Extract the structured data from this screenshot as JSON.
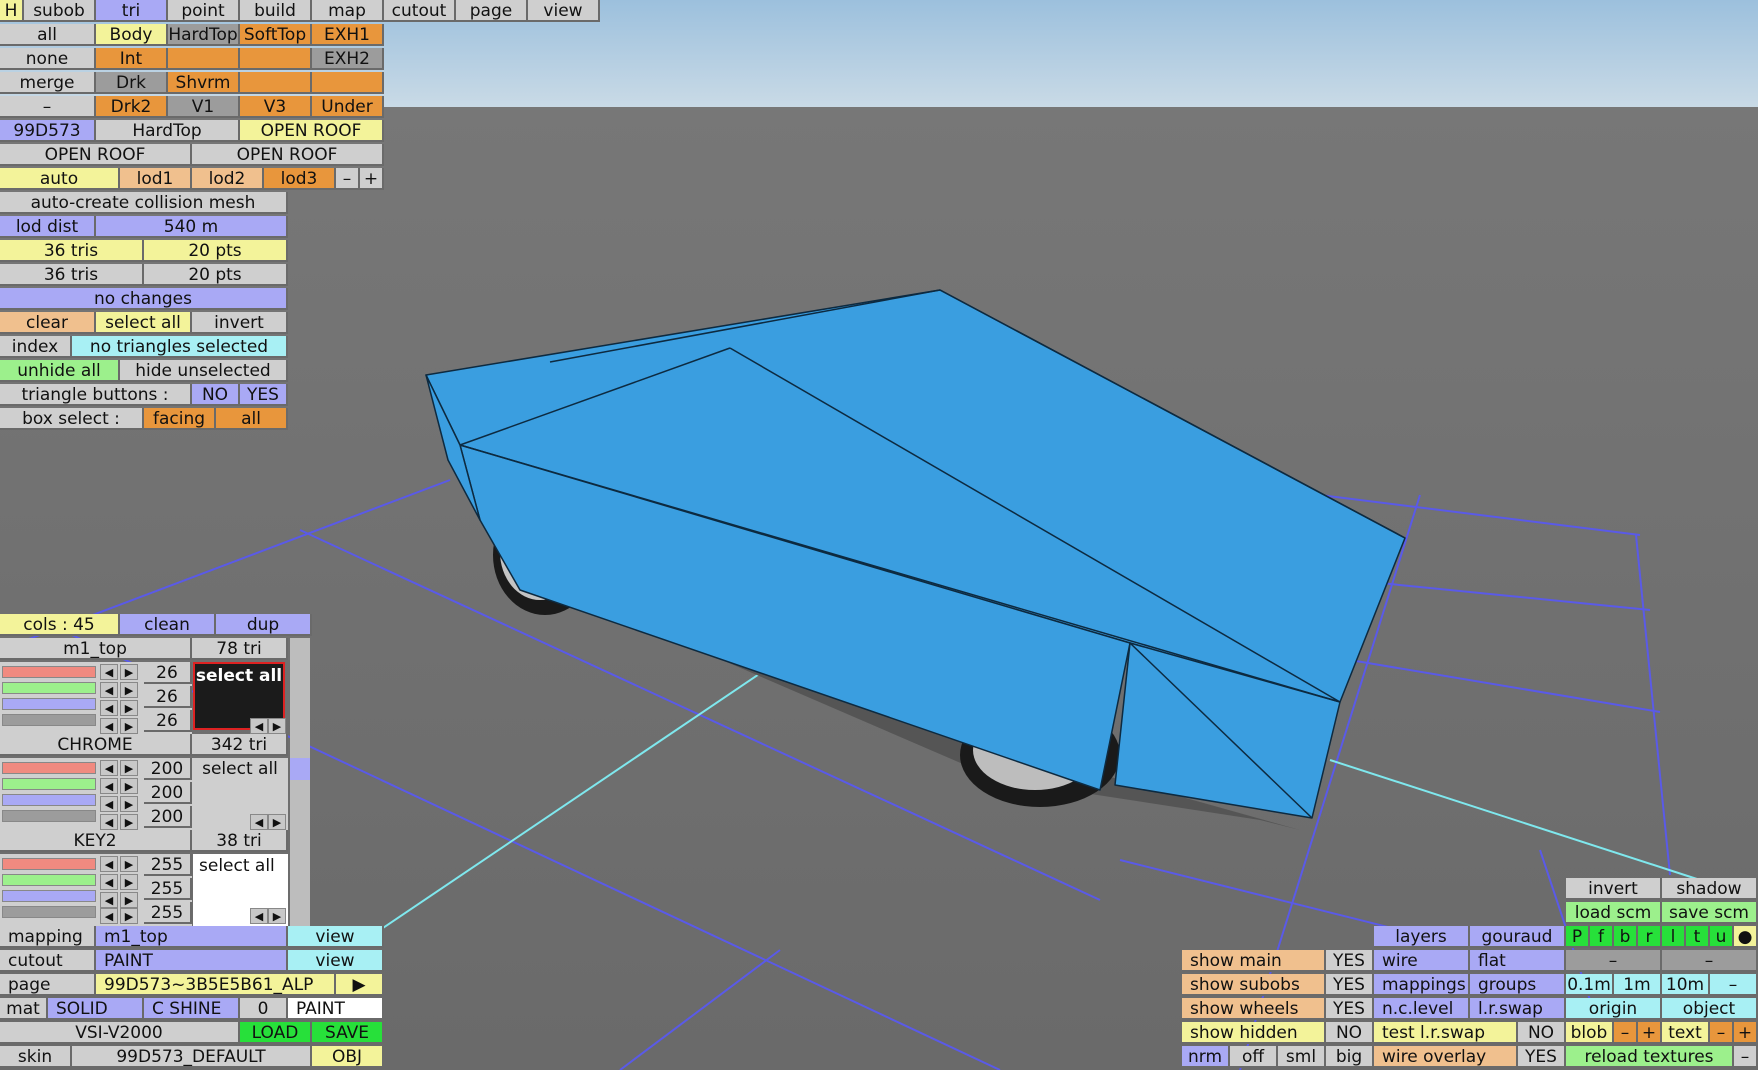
{
  "colors": {
    "car": "#3a9ee0",
    "grid": "#5a5ae8",
    "axis": "#7fe8ee",
    "sky": "#b7d0e2"
  },
  "menu": {
    "h": "H",
    "subob": "subob",
    "tri": "tri",
    "point": "point",
    "build": "build",
    "map": "map",
    "cutout": "cutout",
    "page": "page",
    "view": "view"
  },
  "sel": {
    "all": "all",
    "none": "none",
    "merge": "merge",
    "dash": "–",
    "body": "Body",
    "hardtop": "HardTop",
    "softtop": "SoftTop",
    "exh1": "EXH1",
    "int": "Int",
    "exh2": "EXH2",
    "drk": "Drk",
    "shvrm": "Shvrm",
    "drk2": "Drk2",
    "v1": "V1",
    "v3": "V3",
    "under": "Under"
  },
  "car_row": {
    "code": "99D573",
    "top": "HardTop",
    "roof": "OPEN ROOF"
  },
  "roof_row": {
    "a": "OPEN ROOF",
    "b": "OPEN ROOF"
  },
  "lod": {
    "auto": "auto",
    "lod1": "lod1",
    "lod2": "lod2",
    "lod3": "lod3",
    "minus": "–",
    "plus": "+"
  },
  "collision": "auto-create collision mesh",
  "lod_dist": {
    "label": "lod dist",
    "value": "540 m"
  },
  "stats1": {
    "tris": "36 tris",
    "pts": "20 pts"
  },
  "stats2": {
    "tris": "36 tris",
    "pts": "20 pts"
  },
  "changes": "no changes",
  "selection": {
    "clear": "clear",
    "select_all": "select all",
    "invert": "invert",
    "index": "index",
    "none_selected": "no triangles selected",
    "unhide_all": "unhide all",
    "hide_unselected": "hide unselected"
  },
  "tri_buttons": {
    "label": "triangle buttons :",
    "no": "NO",
    "yes": "YES"
  },
  "box_select": {
    "label": "box select :",
    "facing": "facing",
    "all": "all"
  },
  "cols": {
    "label": "cols : 45",
    "clean": "clean",
    "dup": "dup"
  },
  "materials": [
    {
      "name": "m1_top",
      "tris": "78 tri",
      "r": "26",
      "g": "26",
      "b": "26",
      "action": "select all"
    },
    {
      "name": "CHROME",
      "tris": "342 tri",
      "r": "200",
      "g": "200",
      "b": "200",
      "action": "select all"
    },
    {
      "name": "KEY2",
      "tris": "38 tri",
      "r": "255",
      "g": "255",
      "b": "255",
      "action": "select all"
    }
  ],
  "mapping": {
    "label": "mapping",
    "value": "m1_top",
    "view": "view"
  },
  "cutout": {
    "label": "cutout",
    "value": "PAINT",
    "view": "view"
  },
  "page": {
    "label": "page",
    "value": "99D573~3B5E5B61_ALP",
    "play": "▶"
  },
  "mat": {
    "label": "mat",
    "solid": "SOLID",
    "shine": "C SHINE",
    "zero": "0",
    "paint": "PAINT"
  },
  "file": {
    "name": "VSI-V2000",
    "load": "LOAD",
    "save": "SAVE"
  },
  "skin": {
    "label": "skin",
    "value": "99D573_DEFAULT",
    "obj": "OBJ"
  },
  "view_panel": {
    "invert": "invert",
    "shadow": "shadow",
    "load_scm": "load scm",
    "save_scm": "save scm",
    "views": [
      "P",
      "f",
      "b",
      "r",
      "l",
      "t",
      "u",
      "●"
    ],
    "layers": "layers",
    "gouraud": "gouraud",
    "wire": "wire",
    "flat": "flat",
    "dash1": "–",
    "dash2": "–",
    "mappings": "mappings",
    "groups": "groups",
    "s01": "0.1m",
    "s1": "1m",
    "s10": "10m",
    "sdash": "–",
    "nclevel": "n.c.level",
    "lrswap": "l.r.swap",
    "origin": "origin",
    "object": "object",
    "show_main": "show main",
    "show_main_v": "YES",
    "show_subobs": "show subobs",
    "show_subobs_v": "YES",
    "show_wheels": "show wheels",
    "show_wheels_v": "YES",
    "show_hidden": "show hidden",
    "show_hidden_v": "NO",
    "test_lr": "test l.r.swap",
    "test_lr_v": "NO",
    "blob": "blob",
    "text": "text",
    "minus": "–",
    "plus": "+",
    "nrm": "nrm",
    "off": "off",
    "sml": "sml",
    "big": "big",
    "wire_overlay": "wire overlay",
    "wire_overlay_v": "YES",
    "reload": "reload textures",
    "rdash": "–"
  }
}
